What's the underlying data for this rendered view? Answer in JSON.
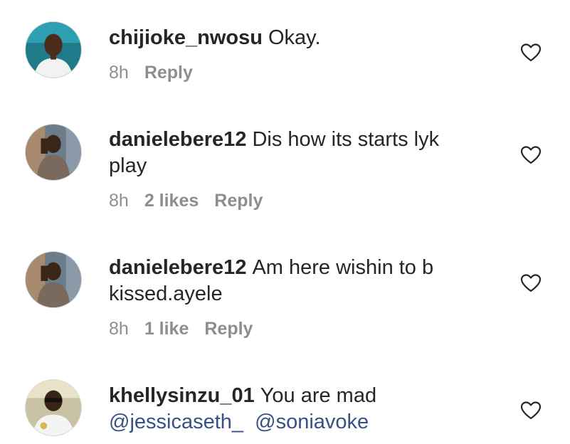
{
  "comments": [
    {
      "username": "chijioke_nwosu",
      "text": "Okay.",
      "time": "8h",
      "likes": "",
      "reply": "Reply",
      "avatar_icon": "avatar-man-white-shirt"
    },
    {
      "username": "danielebere12",
      "text": "Dis how its starts lyk play",
      "time": "8h",
      "likes": "2 likes",
      "reply": "Reply",
      "avatar_icon": "avatar-man-blurry"
    },
    {
      "username": "danielebere12",
      "text": "Am here wishin to b kissed.ayele",
      "time": "8h",
      "likes": "1 like",
      "reply": "Reply",
      "avatar_icon": "avatar-man-blurry"
    },
    {
      "username": "khellysinzu_01",
      "text": "You are mad",
      "mentions": [
        "@jessicaseth_",
        "@soniavoke"
      ],
      "time": "",
      "likes": "",
      "reply": "",
      "avatar_icon": "avatar-man-sunglasses"
    }
  ],
  "icons": {
    "like": "heart-outline-icon"
  },
  "colors": {
    "text": "#262626",
    "meta": "#8e8e8e",
    "mention": "#385185"
  }
}
